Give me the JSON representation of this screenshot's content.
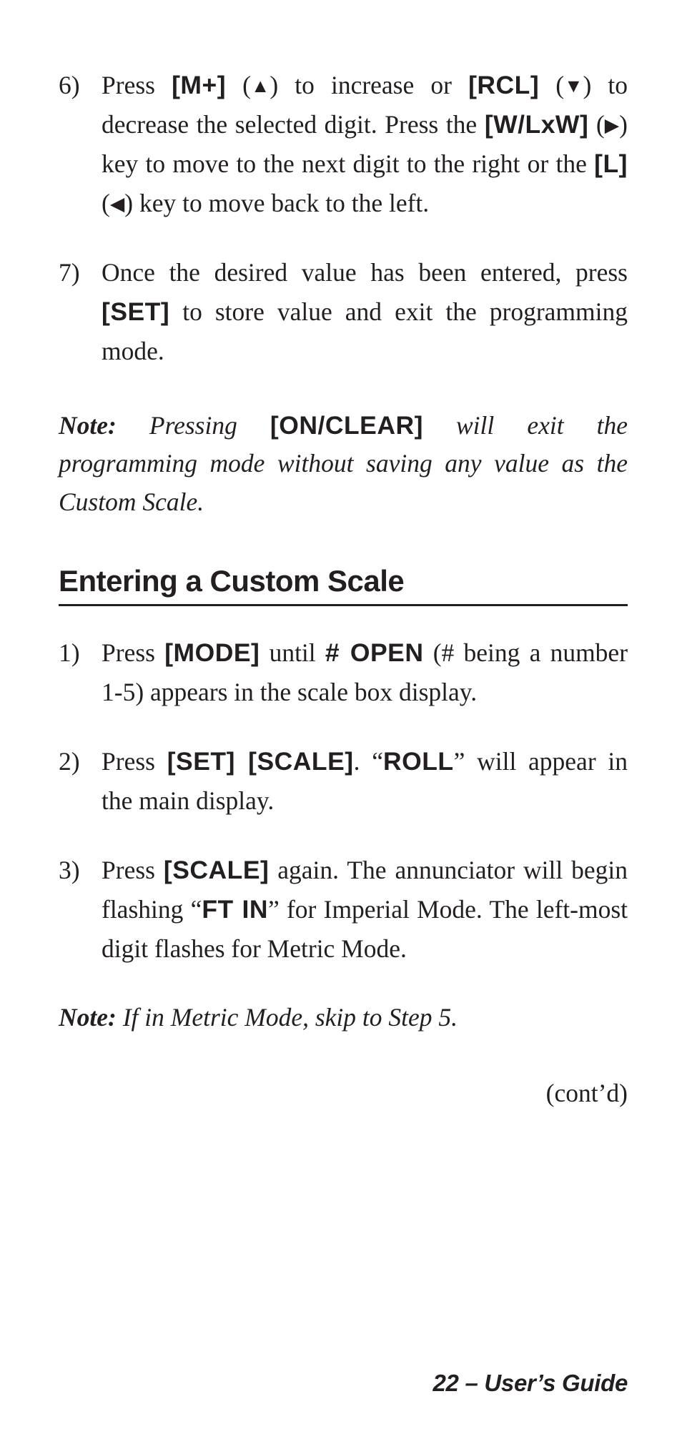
{
  "topList": [
    {
      "marker": "6)",
      "segments": [
        {
          "t": "Press "
        },
        {
          "t": "[M+]",
          "bold": true
        },
        {
          "t": " ("
        },
        {
          "t": "▲",
          "tri": true
        },
        {
          "t": ") to increase or "
        },
        {
          "t": "[RCL]",
          "bold": true
        },
        {
          "t": " ("
        },
        {
          "t": "▼",
          "tri": true
        },
        {
          "t": ") to decrease the selected digit. Press the "
        },
        {
          "t": "[W/LxW]",
          "bold": true
        },
        {
          "t": " ("
        },
        {
          "t": "▶",
          "tri": true
        },
        {
          "t": ") key to move to the next digit to the right or the "
        },
        {
          "t": "[L]",
          "bold": true
        },
        {
          "t": " ("
        },
        {
          "t": "◀",
          "tri": true
        },
        {
          "t": ") key to move back to the left."
        }
      ]
    },
    {
      "marker": "7)",
      "segments": [
        {
          "t": "Once the desired value has been entered, press "
        },
        {
          "t": "[SET]",
          "bold": true
        },
        {
          "t": " to store value and exit the programming mode."
        }
      ]
    }
  ],
  "note1": {
    "label": "Note:",
    "segments": [
      {
        "t": " Pressing "
      },
      {
        "t": "[ON/CLEAR]",
        "bold": true
      },
      {
        "t": " will exit the programming mode without saving any value as the Custom Scale."
      }
    ]
  },
  "heading": "Entering a Custom Scale",
  "secondList": [
    {
      "marker": "1)",
      "segments": [
        {
          "t": "Press "
        },
        {
          "t": "[MODE]",
          "bold": true
        },
        {
          "t": " until "
        },
        {
          "t": "# OPEN",
          "bold": true
        },
        {
          "t": " (# being a number 1-5) appears in the scale box display."
        }
      ]
    },
    {
      "marker": "2)",
      "segments": [
        {
          "t": "Press "
        },
        {
          "t": "[SET] [SCALE]",
          "bold": true
        },
        {
          "t": ". “"
        },
        {
          "t": "ROLL",
          "bold": true
        },
        {
          "t": "” will appear in the main display."
        }
      ]
    },
    {
      "marker": "3)",
      "segments": [
        {
          "t": "Press "
        },
        {
          "t": "[SCALE]",
          "bold": true
        },
        {
          "t": " again. The annunciator will begin flashing “"
        },
        {
          "t": "FT IN",
          "bold": true
        },
        {
          "t": "” for Imperial Mode. The left-most digit flashes for Metric Mode."
        }
      ]
    }
  ],
  "note2": {
    "label": "Note:",
    "body": " If in Metric Mode, skip to Step 5."
  },
  "contd": "(cont’d)",
  "footer": "22 – User’s Guide"
}
